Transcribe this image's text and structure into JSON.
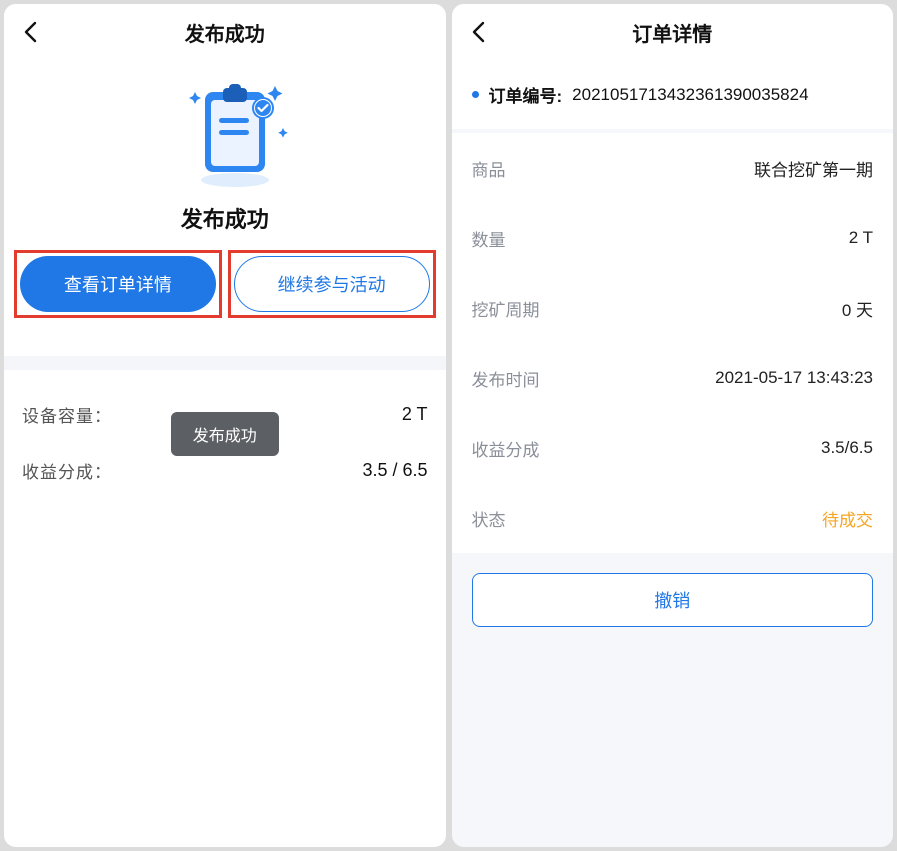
{
  "left": {
    "header_title": "发布成功",
    "success_text": "发布成功",
    "btn_view_order": "查看订单详情",
    "btn_continue": "继续参与活动",
    "toast": "发布成功",
    "rows": {
      "capacity_label": "设备容量：",
      "capacity_value": "2 T",
      "share_label": "收益分成：",
      "share_value": "3.5 / 6.5"
    }
  },
  "right": {
    "header_title": "订单详情",
    "order_no_label": "订单编号:",
    "order_no_value": "2021051713432361390035824",
    "details": [
      {
        "k": "商品",
        "v": "联合挖矿第一期"
      },
      {
        "k": "数量",
        "v": "2 T"
      },
      {
        "k": "挖矿周期",
        "v": "0 天"
      },
      {
        "k": "发布时间",
        "v": "2021-05-17 13:43:23"
      },
      {
        "k": "收益分成",
        "v": "3.5/6.5"
      },
      {
        "k": "状态",
        "v": "待成交",
        "pending": true
      }
    ],
    "cancel_label": "撤销"
  }
}
